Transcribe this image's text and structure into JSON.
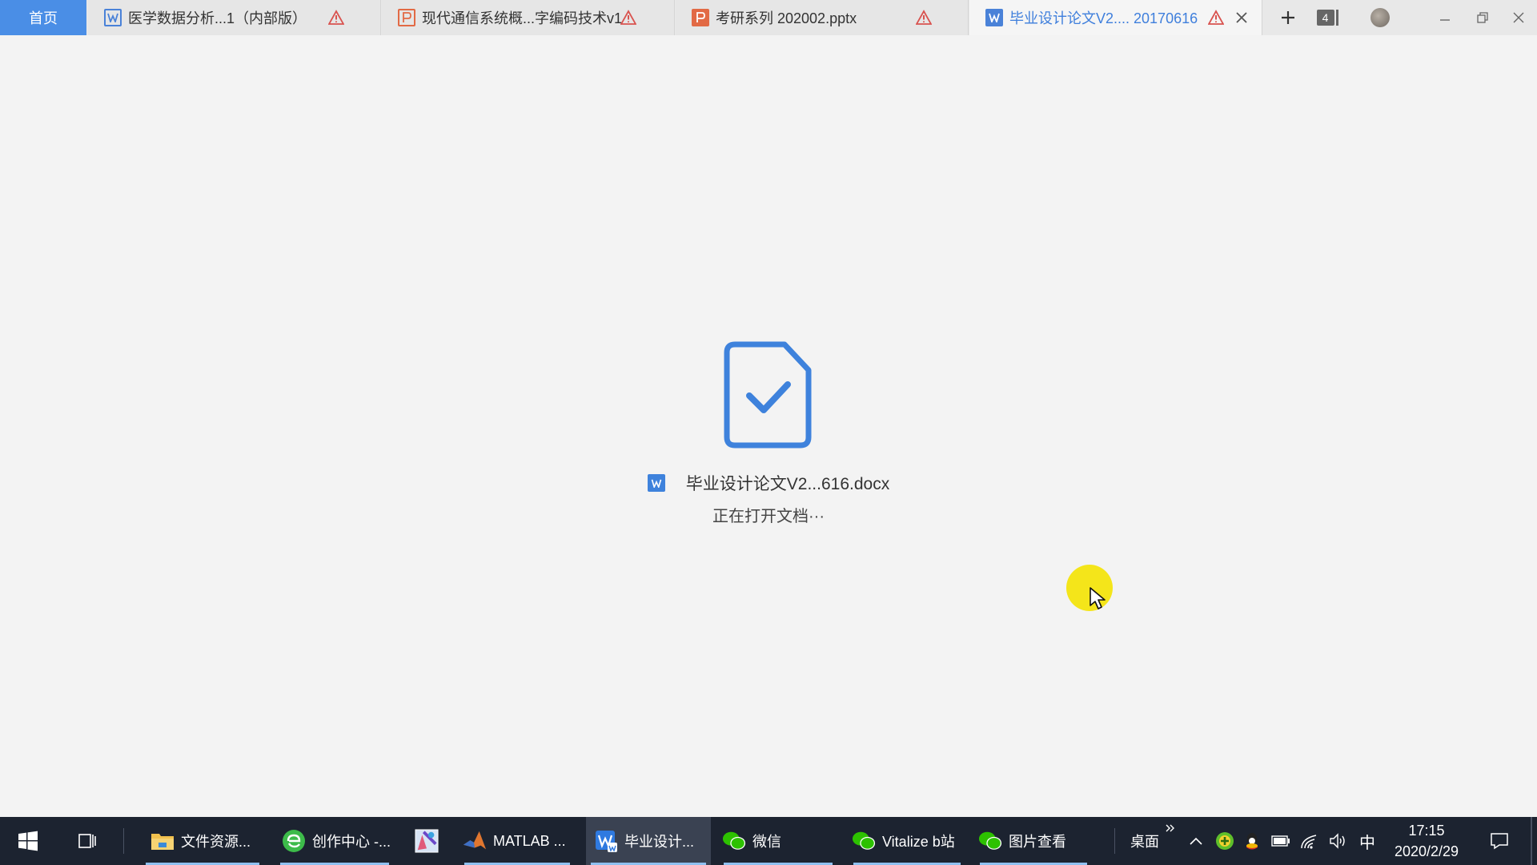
{
  "tabs": {
    "home_label": "首页",
    "items": [
      {
        "label": "医学数据分析...1（内部版）",
        "type": "word",
        "warning": true,
        "active": false
      },
      {
        "label": "现代通信系统概...字编码技术v1",
        "type": "ppt",
        "warning": true,
        "active": false
      },
      {
        "label": "考研系列 202002.pptx",
        "type": "ppt",
        "warning": true,
        "active": false
      },
      {
        "label": "毕业设计论文V2.... 20170616",
        "type": "word",
        "warning": true,
        "active": true
      }
    ],
    "window_count": "4"
  },
  "loading": {
    "file_name": "毕业设计论文V2...616.docx",
    "status": "正在打开文档···"
  },
  "taskbar": {
    "items": [
      {
        "label": "文件资源...",
        "icon": "folder-icon"
      },
      {
        "label": "创作中心 -...",
        "icon": "browser-icon"
      },
      {
        "label": "",
        "icon": "paint-app-icon"
      },
      {
        "label": "MATLAB ...",
        "icon": "matlab-icon"
      },
      {
        "label": "毕业设计...",
        "icon": "wps-writer-icon"
      },
      {
        "label": "微信",
        "icon": "wechat-icon"
      },
      {
        "label": "Vitalize b站",
        "icon": "wechat-icon"
      },
      {
        "label": "图片查看",
        "icon": "wechat-icon"
      }
    ],
    "desktop_label": "桌面",
    "ime_label": "中",
    "time": "17:15",
    "date": "2020/2/29"
  },
  "colors": {
    "accent": "#4a8ee6",
    "word_blue": "#4a82d8",
    "ppt_orange": "#e26a45",
    "warning_red": "#d9534f",
    "taskbar_bg": "#1c2330"
  }
}
